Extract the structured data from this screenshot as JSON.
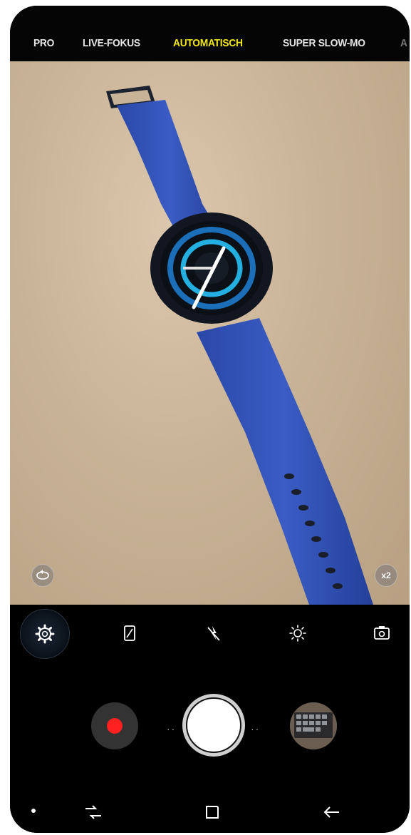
{
  "camera_modes": {
    "items": [
      {
        "label": "PRO",
        "active": false
      },
      {
        "label": "LIVE-FOKUS",
        "active": false
      },
      {
        "label": "AUTOMATISCH",
        "active": true
      },
      {
        "label": "SUPER SLOW-MO",
        "active": false
      },
      {
        "label": "A",
        "active": false
      }
    ],
    "active_color": "#f2e51c"
  },
  "viewfinder": {
    "zoom_label": "x2",
    "switch_camera_icon": "swap-lens-icon"
  },
  "quick_settings": [
    {
      "icon": "gear-icon"
    },
    {
      "icon": "aspect-ratio-icon"
    },
    {
      "icon": "flash-off-icon"
    },
    {
      "icon": "filter-effect-icon"
    },
    {
      "icon": "flip-camera-icon"
    }
  ],
  "shutter": {
    "record_color": "#ff2020"
  },
  "navigation": {
    "buttons": [
      "recent-apps-icon",
      "home-icon",
      "back-icon"
    ]
  }
}
